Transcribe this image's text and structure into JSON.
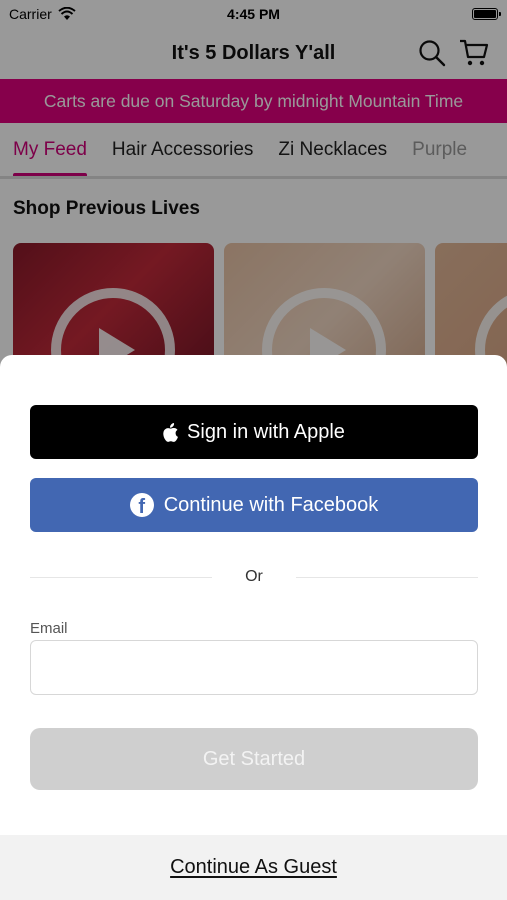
{
  "status_bar": {
    "carrier": "Carrier",
    "time": "4:45 PM"
  },
  "nav": {
    "title": "It's 5 Dollars Y'all",
    "search_icon": "search-icon",
    "cart_icon": "cart-icon"
  },
  "banner": {
    "text": "Carts are due on Saturday by midnight Mountain Time",
    "color": "#e0007e"
  },
  "tabs": [
    {
      "label": "My Feed",
      "active": true
    },
    {
      "label": "Hair Accessories",
      "active": false
    },
    {
      "label": "Zi Necklaces",
      "active": false
    },
    {
      "label": "Purple",
      "active": false
    }
  ],
  "section": {
    "title": "Shop Previous Lives"
  },
  "sheet": {
    "apple_button": "Sign in with Apple",
    "facebook_button": "Continue with Facebook",
    "or_text": "Or",
    "email_label": "Email",
    "email_value": "",
    "get_started": "Get Started",
    "guest_link": "Continue As Guest"
  },
  "colors": {
    "accent": "#d1007a",
    "facebook": "#4267b2",
    "apple": "#000000"
  }
}
